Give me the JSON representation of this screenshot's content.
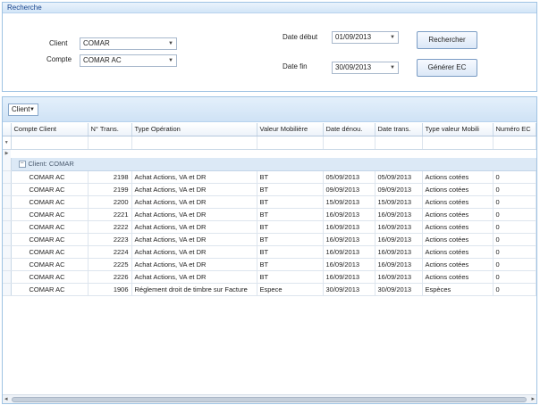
{
  "search": {
    "title": "Recherche",
    "client_label": "Client",
    "client_value": "COMAR",
    "compte_label": "Compte",
    "compte_value": "COMAR AC",
    "date_debut_label": "Date début",
    "date_debut_value": "01/09/2013",
    "date_fin_label": "Date fin",
    "date_fin_value": "30/09/2013",
    "rechercher_label": "Rechercher",
    "generer_label": "Générer EC"
  },
  "grouping": {
    "chip_label": "Client"
  },
  "grid": {
    "columns": [
      "Compte Client",
      "N° Trans.",
      "Type Opération",
      "Valeur Mobilière",
      "Date dénou.",
      "Date trans.",
      "Type valeur Mobili",
      "Numéro EC"
    ],
    "group_label": "Client: COMAR",
    "rows": [
      [
        "COMAR AC",
        "2198",
        "Achat Actions, VA et DR",
        "BT",
        "05/09/2013",
        "05/09/2013",
        "Actions cotées",
        "0"
      ],
      [
        "COMAR AC",
        "2199",
        "Achat Actions, VA et DR",
        "BT",
        "09/09/2013",
        "09/09/2013",
        "Actions cotées",
        "0"
      ],
      [
        "COMAR AC",
        "2200",
        "Achat Actions, VA et DR",
        "BT",
        "15/09/2013",
        "15/09/2013",
        "Actions cotées",
        "0"
      ],
      [
        "COMAR AC",
        "2221",
        "Achat Actions, VA et DR",
        "BT",
        "16/09/2013",
        "16/09/2013",
        "Actions cotées",
        "0"
      ],
      [
        "COMAR AC",
        "2222",
        "Achat Actions, VA et DR",
        "BT",
        "16/09/2013",
        "16/09/2013",
        "Actions cotées",
        "0"
      ],
      [
        "COMAR AC",
        "2223",
        "Achat Actions, VA et DR",
        "BT",
        "16/09/2013",
        "16/09/2013",
        "Actions cotées",
        "0"
      ],
      [
        "COMAR AC",
        "2224",
        "Achat Actions, VA et DR",
        "BT",
        "16/09/2013",
        "16/09/2013",
        "Actions cotées",
        "0"
      ],
      [
        "COMAR AC",
        "2225",
        "Achat Actions, VA et DR",
        "BT",
        "16/09/2013",
        "16/09/2013",
        "Actions cotées",
        "0"
      ],
      [
        "COMAR AC",
        "2226",
        "Achat Actions, VA et DR",
        "BT",
        "16/09/2013",
        "16/09/2013",
        "Actions cotées",
        "0"
      ],
      [
        "COMAR AC",
        "1906",
        "Réglement droit de timbre sur Facture",
        "Espece",
        "30/09/2013",
        "30/09/2013",
        "Espèces",
        "0"
      ]
    ]
  },
  "icons": {
    "dropdown": "chevron-down-icon",
    "filter_row": "filter-icon",
    "current_row": "row-pointer-icon",
    "collapse": "collapse-icon"
  },
  "colors": {
    "panel_border": "#9fc3e3",
    "header_bg": "#d3e5f7",
    "group_row_bg": "#dce9f6"
  }
}
